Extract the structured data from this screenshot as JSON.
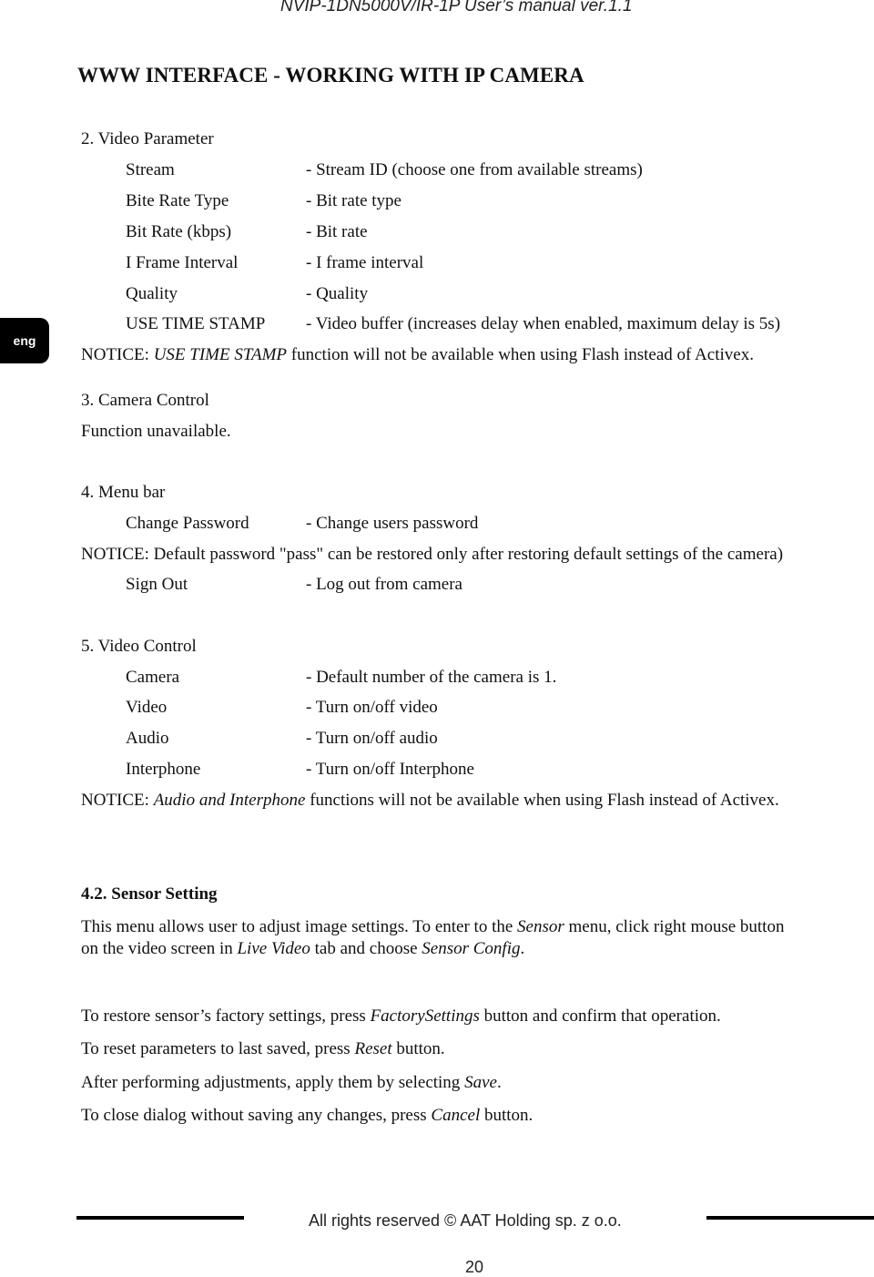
{
  "header": {
    "title": "NVIP-1DN5000V/IR-1P User’s manual ver.1.1"
  },
  "section_title": "WWW INTERFACE - WORKING WITH IP CAMERA",
  "lang_tab": "eng",
  "video_parameter": {
    "heading": "2. Video Parameter",
    "rows": [
      {
        "label": "Stream",
        "desc": "- Stream ID (choose one from available streams)"
      },
      {
        "label": "Bite Rate Type",
        "desc": "- Bit rate type"
      },
      {
        "label": "Bit Rate (kbps)",
        "desc": "- Bit rate"
      },
      {
        "label": "I Frame Interval",
        "desc": "- I frame interval"
      },
      {
        "label": "Quality",
        "desc": "- Quality"
      },
      {
        "label": "USE TIME STAMP",
        "desc": "- Video buffer (increases delay when enabled, maximum delay is 5s)"
      }
    ],
    "notice": {
      "prefix": "NOTICE: ",
      "emph": "USE TIME STAMP",
      "rest": " function will not be available when using Flash instead of Activex."
    }
  },
  "camera_control": {
    "heading": "3. Camera Control",
    "text": "Function unavailable."
  },
  "menu_bar": {
    "heading": "4. Menu bar",
    "rows": [
      {
        "label": "Change Password",
        "desc": "- Change users password"
      },
      {
        "label": "Sign Out",
        "desc": "- Log out from camera"
      }
    ],
    "notice": "NOTICE: Default password \"pass\" can be restored only after restoring default settings of the camera)"
  },
  "video_control": {
    "heading": "5. Video Control",
    "rows": [
      {
        "label": "Camera",
        "desc": "- Default number of the camera is 1."
      },
      {
        "label": "Video",
        "desc": "- Turn on/off video"
      },
      {
        "label": "Audio",
        "desc": "- Turn on/off audio"
      },
      {
        "label": "Interphone",
        "desc": "- Turn on/off Interphone"
      }
    ],
    "notice": {
      "prefix": "NOTICE: ",
      "emph": "Audio and Interphone",
      "rest": " functions will not be available when using Flash instead of Activex."
    }
  },
  "sensor_setting": {
    "heading": "4.2. Sensor Setting",
    "intro_1": {
      "a": "This menu allows user to adjust image settings. To enter to the ",
      "b": "Sensor",
      "c": " menu, click right mouse button"
    },
    "intro_2": {
      "a": "on the video screen in ",
      "b": "Live Video",
      "c": " tab and choose ",
      "d": "Sensor Config",
      "e": "."
    },
    "lines": [
      {
        "a": "To restore sensor’s factory settings, press ",
        "b": "FactorySettings",
        "c": " button and confirm that operation."
      },
      {
        "a": "To reset parameters to last saved, press ",
        "b": "Reset",
        "c": " button."
      },
      {
        "a": "After performing adjustments, apply them by selecting ",
        "b": "Save",
        "c": "."
      },
      {
        "a": "To close dialog without saving any changes, press ",
        "b": "Cancel",
        "c": " button."
      }
    ]
  },
  "footer": {
    "copyright": "All rights reserved © AAT Holding sp. z o.o.",
    "page_number": "20"
  }
}
